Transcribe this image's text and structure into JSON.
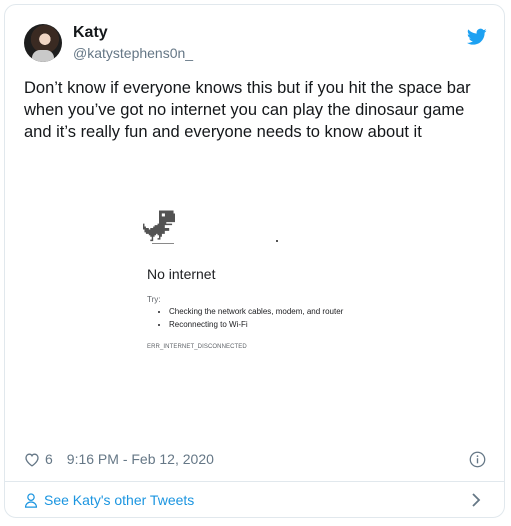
{
  "tweet": {
    "author_name": "Katy",
    "author_handle": "@katystephens0n_",
    "text": "Don’t know if everyone knows this but if you hit the space bar when you’ve got no internet you can play the dinosaur game and it’s really fun and everyone needs to know about it",
    "like_count": "6",
    "timestamp": "9:16 PM - Feb 12, 2020"
  },
  "media": {
    "heading": "No internet",
    "try_label": "Try:",
    "suggestions": [
      "Checking the network cables, modem, and router",
      "Reconnecting to Wi-Fi"
    ],
    "error_code": "ERR_INTERNET_DISCONNECTED"
  },
  "footer": {
    "see_more_label": "See Katy's other Tweets"
  },
  "icons": {
    "bird": "twitter-bird-icon",
    "heart": "heart-outline-icon",
    "info": "info-circle-icon",
    "user": "user-icon",
    "chevron": "chevron-right-icon"
  },
  "colors": {
    "brand_blue": "#1da1f2",
    "link_blue": "#1b95e0",
    "secondary_text": "#657786",
    "border": "#e1e8ed"
  }
}
